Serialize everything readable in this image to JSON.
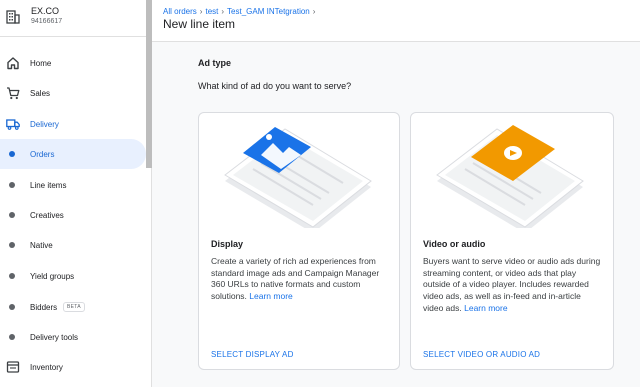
{
  "account": {
    "name": "EX.CO",
    "id": "94166617",
    "icon": "building-icon"
  },
  "nav": [
    {
      "name": "nav-home",
      "label": "Home",
      "icon": "home-icon",
      "type": "top"
    },
    {
      "name": "nav-sales",
      "label": "Sales",
      "icon": "cart-icon",
      "type": "top"
    },
    {
      "name": "nav-delivery",
      "label": "Delivery",
      "icon": "truck-icon",
      "type": "top",
      "state": "expanded"
    },
    {
      "name": "nav-orders",
      "label": "Orders",
      "type": "sub",
      "state": "selected"
    },
    {
      "name": "nav-line-items",
      "label": "Line items",
      "type": "sub"
    },
    {
      "name": "nav-creatives",
      "label": "Creatives",
      "type": "sub"
    },
    {
      "name": "nav-native",
      "label": "Native",
      "type": "sub"
    },
    {
      "name": "nav-yield-groups",
      "label": "Yield groups",
      "type": "sub"
    },
    {
      "name": "nav-bidders",
      "label": "Bidders",
      "type": "sub",
      "badge": "BETA"
    },
    {
      "name": "nav-delivery-tools",
      "label": "Delivery tools",
      "type": "sub"
    },
    {
      "name": "nav-inventory",
      "label": "Inventory",
      "icon": "inventory-icon",
      "type": "top"
    }
  ],
  "breadcrumb": [
    "All orders",
    "test",
    "Test_GAM INTetgration"
  ],
  "page_title": "New line item",
  "ad_type": {
    "heading": "Ad type",
    "question": "What kind of ad do you want to serve?"
  },
  "cards": {
    "display": {
      "title": "Display",
      "description": "Create a variety of rich ad experiences from standard image ads and Campaign Manager 360 URLs to native formats and custom solutions.",
      "learn_more": "Learn more",
      "button": "SELECT DISPLAY AD",
      "accent": "#1a73e8"
    },
    "video": {
      "title": "Video or audio",
      "description": "Buyers want to serve video or audio ads during streaming content, or video ads that play outside of a video player. Includes rewarded video ads, as well as in-feed and in-article video ads.",
      "learn_more": "Learn more",
      "button": "SELECT VIDEO OR AUDIO AD",
      "accent": "#f29900"
    }
  },
  "colors": {
    "link": "#1a73e8",
    "selected_bg": "#e8f0fe",
    "text": "#202124"
  }
}
